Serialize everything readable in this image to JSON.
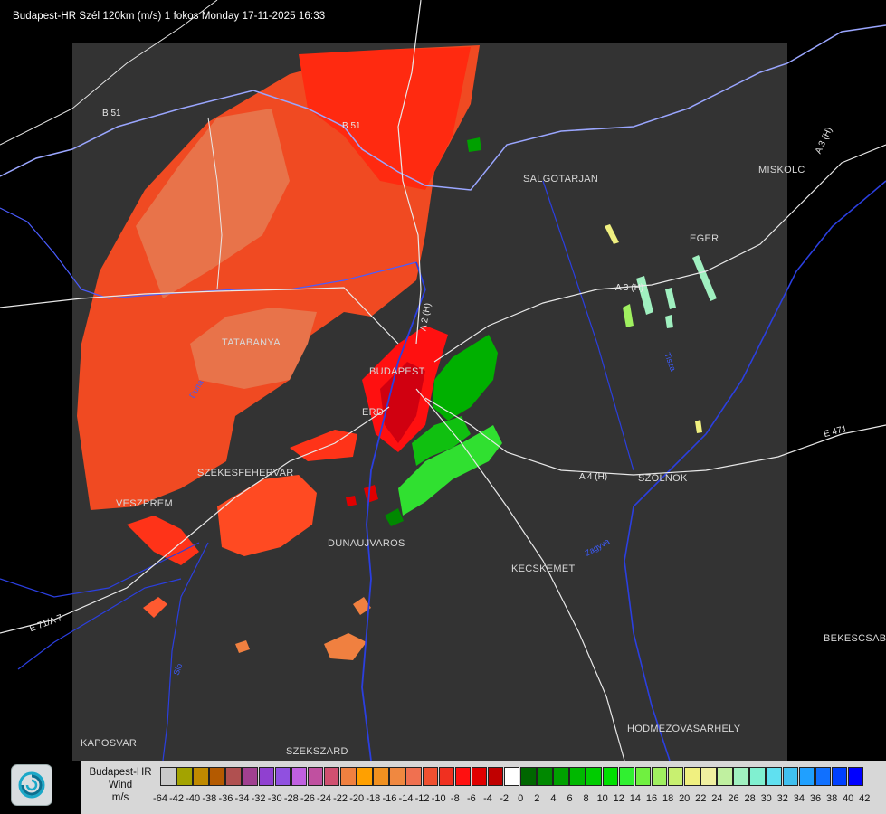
{
  "title": "Budapest-HR Szél 120km (m/s) 1 fokos Monday 17-11-2025 16:33",
  "cities": [
    {
      "name": "SALGOTARJAN"
    },
    {
      "name": "MISKOLC"
    },
    {
      "name": "EGER"
    },
    {
      "name": "TATABANYA"
    },
    {
      "name": "BUDAPEST"
    },
    {
      "name": "ERD"
    },
    {
      "name": "SZEKESFEHERVAR"
    },
    {
      "name": "VESZPREM"
    },
    {
      "name": "DUNAUJVAROS"
    },
    {
      "name": "KECSKEMET"
    },
    {
      "name": "SZOLNOK"
    },
    {
      "name": "BEKESCSABA"
    },
    {
      "name": "HODMEZOVASARHELY"
    },
    {
      "name": "KAPOSVAR"
    },
    {
      "name": "SZEKSZARD"
    }
  ],
  "road_labels": [
    {
      "text": "B 51"
    },
    {
      "text": "B 51"
    },
    {
      "text": "A 3 (H)"
    },
    {
      "text": "A 3 (H)"
    },
    {
      "text": "A 2 (H)"
    },
    {
      "text": "A 4 (H)"
    },
    {
      "text": "E 471"
    },
    {
      "text": "E 71/A 7"
    }
  ],
  "river_labels": [
    {
      "text": "Tisza"
    },
    {
      "text": "Zagyva"
    },
    {
      "text": "Sio"
    },
    {
      "text": "Duna"
    }
  ],
  "legend": {
    "name_line1": "Budapest-HR",
    "name_line2": "Wind",
    "unit": "m/s",
    "tick_labels": [
      "-64",
      "-42",
      "-40",
      "-38",
      "-36",
      "-34",
      "-32",
      "-30",
      "-28",
      "-26",
      "-24",
      "-22",
      "-20",
      "-18",
      "-16",
      "-14",
      "-12",
      "-10",
      "-8",
      "-6",
      "-4",
      "-2",
      "0",
      "2",
      "4",
      "6",
      "8",
      "10",
      "12",
      "14",
      "16",
      "18",
      "20",
      "22",
      "24",
      "26",
      "28",
      "30",
      "32",
      "34",
      "36",
      "38",
      "40",
      "42"
    ],
    "colors": [
      "#c9c9c9",
      "#a3a300",
      "#c08a00",
      "#b45a00",
      "#b05050",
      "#a04090",
      "#9040d0",
      "#9050e0",
      "#c060e0",
      "#c050a0",
      "#d05070",
      "#f08040",
      "#ffa000",
      "#f09020",
      "#f08840",
      "#f07050",
      "#f05030",
      "#f03020",
      "#ff1010",
      "#e00000",
      "#c00000",
      "#ffffff",
      "#006600",
      "#008800",
      "#00a000",
      "#00b800",
      "#00cc00",
      "#00e000",
      "#30f030",
      "#70f040",
      "#a0f060",
      "#c8f070",
      "#f0f080",
      "#f0f0a0",
      "#c0f0a0",
      "#a0f0c0",
      "#80f0d0",
      "#60e0f0",
      "#40c0f0",
      "#20a0ff",
      "#1070ff",
      "#0040ff",
      "#0000ff"
    ]
  }
}
